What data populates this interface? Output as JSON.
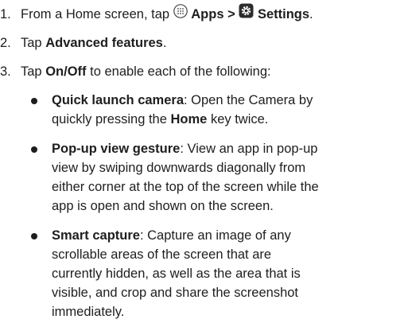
{
  "steps": [
    {
      "number": "1.",
      "prefix": "From a Home screen, tap",
      "apps_label": "Apps",
      "separator": ">",
      "settings_label": "Settings",
      "suffix": "."
    },
    {
      "number": "2.",
      "prefix": "Tap",
      "bold": "Advanced features",
      "suffix": "."
    },
    {
      "number": "3.",
      "prefix": "Tap",
      "bold": "On/Off",
      "suffix": "to enable each of the following:"
    }
  ],
  "bullets": [
    {
      "title": "Quick launch camera",
      "lines": [
        ": Open the Camera by",
        "quickly pressing the ",
        "key twice."
      ],
      "inline_bold": "Home"
    },
    {
      "title": "Pop-up view gesture",
      "lines": [
        ": View an app in pop-up",
        "view by swiping downwards diagonally from",
        "either corner at the top of the screen while the",
        "app is open and shown on the screen."
      ]
    },
    {
      "title": "Smart capture",
      "lines": [
        ": Capture an image of any",
        "scrollable areas of the screen that are",
        "currently hidden, as well as the area that is",
        "visible, and crop and share the screenshot",
        "immediately."
      ]
    }
  ],
  "icons": {
    "apps": "apps-grid-icon",
    "settings": "settings-gear-icon"
  }
}
